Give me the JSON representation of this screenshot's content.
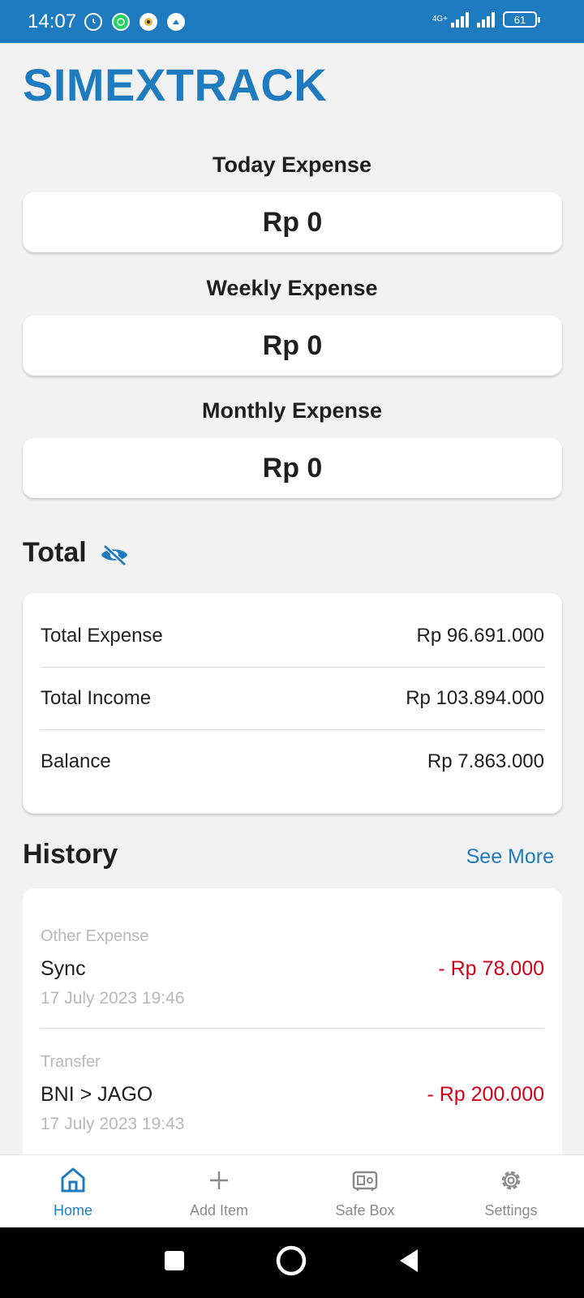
{
  "status_bar": {
    "time": "14:07",
    "network": "4G+",
    "battery": "61",
    "colors": {
      "background": "#1f7bbf"
    }
  },
  "app": {
    "title": "SIMEXTRACK",
    "accent_color": "#1f7bbf"
  },
  "summary": {
    "today": {
      "label": "Today Expense",
      "value": "Rp 0"
    },
    "weekly": {
      "label": "Weekly Expense",
      "value": "Rp 0"
    },
    "monthly": {
      "label": "Monthly Expense",
      "value": "Rp 0"
    }
  },
  "total": {
    "heading": "Total",
    "toggle_icon": "eye-off-icon",
    "rows": [
      {
        "label": "Total Expense",
        "value": "Rp 96.691.000"
      },
      {
        "label": "Total Income",
        "value": "Rp 103.894.000"
      },
      {
        "label": "Balance",
        "value": "Rp 7.863.000"
      }
    ]
  },
  "history": {
    "heading": "History",
    "see_more": "See More",
    "items": [
      {
        "category": "Other Expense",
        "name": "Sync",
        "amount": "- Rp 78.000",
        "date": "17 July 2023 19:46"
      },
      {
        "category": "Transfer",
        "name": "BNI > JAGO",
        "amount": "- Rp 200.000",
        "date": "17 July 2023 19:43"
      }
    ],
    "amount_color": "#d0021b"
  },
  "bottom_nav": {
    "items": [
      {
        "label": "Home",
        "icon": "home-icon",
        "active": true
      },
      {
        "label": "Add Item",
        "icon": "plus-icon",
        "active": false
      },
      {
        "label": "Safe Box",
        "icon": "safe-box-icon",
        "active": false
      },
      {
        "label": "Settings",
        "icon": "gear-icon",
        "active": false
      }
    ]
  },
  "system_nav": {
    "buttons": [
      "recents-icon",
      "home-circle-icon",
      "back-icon"
    ]
  }
}
